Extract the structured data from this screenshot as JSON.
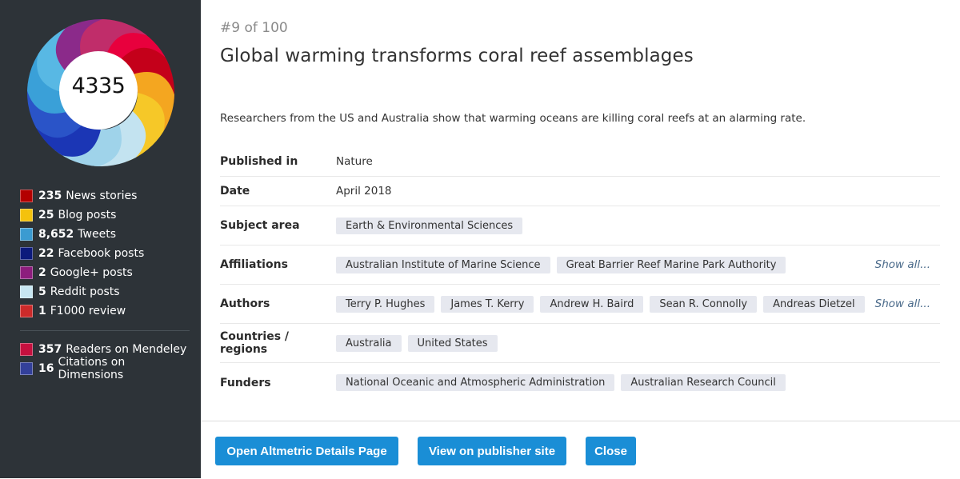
{
  "sidebar": {
    "score": "4335",
    "donut_colors": [
      "#e8003d",
      "#c4001a",
      "#f4a620",
      "#f6c828",
      "#c3e3f0",
      "#9fd3ea",
      "#1b36b5",
      "#2a54c8",
      "#3aa0d8",
      "#58b8e4",
      "#8b2a8a",
      "#c02d6a"
    ],
    "stats": [
      {
        "count": "235",
        "label": "News stories",
        "color": "#b30000"
      },
      {
        "count": "25",
        "label": "Blog posts",
        "color": "#f4c20d"
      },
      {
        "count": "8,652",
        "label": "Tweets",
        "color": "#3b9bd1"
      },
      {
        "count": "22",
        "label": "Facebook posts",
        "color": "#0c1a7c"
      },
      {
        "count": "2",
        "label": "Google+ posts",
        "color": "#8d1d7d"
      },
      {
        "count": "5",
        "label": "Reddit posts",
        "color": "#c7e6f2"
      },
      {
        "count": "1",
        "label": "F1000 review",
        "color": "#cc2a2a"
      }
    ],
    "stats2": [
      {
        "count": "357",
        "label": "Readers on Mendeley",
        "color": "#c6103f"
      },
      {
        "count": "16",
        "label": "Citations on Dimensions",
        "color": "#33409a"
      }
    ]
  },
  "main": {
    "rank": "#9 of 100",
    "title": "Global warming transforms coral reef assemblages",
    "summary": "Researchers from the US and Australia show that warming oceans are killing coral reefs at an alarming rate.",
    "published_label": "Published in",
    "published_value": "Nature",
    "date_label": "Date",
    "date_value": "April 2018",
    "subject_label": "Subject area",
    "subjects": [
      "Earth & Environmental Sciences"
    ],
    "affiliations_label": "Affiliations",
    "affiliations": [
      "Australian Institute of Marine Science",
      "Great Barrier Reef Marine Park Authority"
    ],
    "authors_label": "Authors",
    "authors": [
      "Terry P. Hughes",
      "James T. Kerry",
      "Andrew H. Baird",
      "Sean R. Connolly",
      "Andreas Dietzel"
    ],
    "countries_label": "Countries / regions",
    "countries": [
      "Australia",
      "United States"
    ],
    "funders_label": "Funders",
    "funders": [
      "National Oceanic and Atmospheric Administration",
      "Australian Research Council"
    ],
    "show_all": "Show all..."
  },
  "footer": {
    "details_button": "Open Altmetric Details Page",
    "publisher_button": "View on publisher site",
    "close_button": "Close"
  }
}
